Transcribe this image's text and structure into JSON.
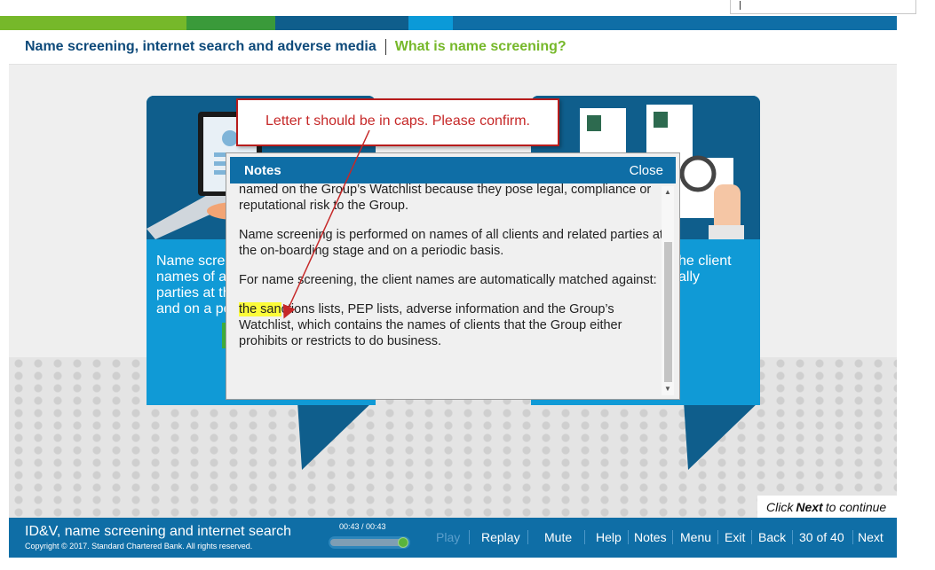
{
  "top_bar": {
    "segments": [
      {
        "color": "#76b82a",
        "width": 210
      },
      {
        "color": "#3a9a3a",
        "width": 100
      },
      {
        "color": "#0f5e8c",
        "width": 150
      },
      {
        "color": "#0b9ad8",
        "width": 50
      },
      {
        "color": "#0f6ea6",
        "width": 500
      }
    ]
  },
  "breadcrumb": {
    "module": "Name screening, internet search and adverse media",
    "topic": "What is name screening?"
  },
  "cards": {
    "left_text": [
      "Name scre",
      "names of a",
      "parties at th",
      "and on a pe"
    ],
    "right_text": [
      "he client",
      "ally"
    ]
  },
  "notes": {
    "title": "Notes",
    "close_label": "Close",
    "paragraphs": [
      "procedures and in Group Sanctions Policy and procedures, or who is named on the Group’s Watchlist because they pose legal, compliance or reputational risk to the Group.",
      "Name screening is performed on names of all clients and related parties at the on-boarding stage and on a periodic basis.",
      "For name screening, the client names are automatically matched against:"
    ],
    "highlighted_prefix": "the san",
    "last_paragraph_rest": "ctions lists, PEP lists, adverse information and the Group’s Watchlist, which contains the names of clients that the Group either prohibits or restricts to do business."
  },
  "comment": {
    "text": "Letter t should be in caps. Please confirm."
  },
  "hint": {
    "prefix": "Click",
    "emphasis": "Next",
    "suffix": "to continue"
  },
  "footer": {
    "course_title": "ID&V, name screening and internet search",
    "copyright": "Copyright © 2017. Standard Chartered Bank. All rights reserved.",
    "time": "00:43 / 00:43",
    "progress_fraction": 1.0,
    "nav": {
      "play": "Play",
      "replay": "Replay",
      "mute": "Mute",
      "help": "Help",
      "notes": "Notes",
      "menu": "Menu",
      "exit": "Exit",
      "back": "Back",
      "page_indicator": "30 of 40",
      "next": "Next"
    }
  },
  "colors": {
    "brand_blue": "#0f6ea6",
    "card_blue": "#109ad6",
    "accent_green": "#76b82a",
    "comment_red": "#c62828"
  }
}
